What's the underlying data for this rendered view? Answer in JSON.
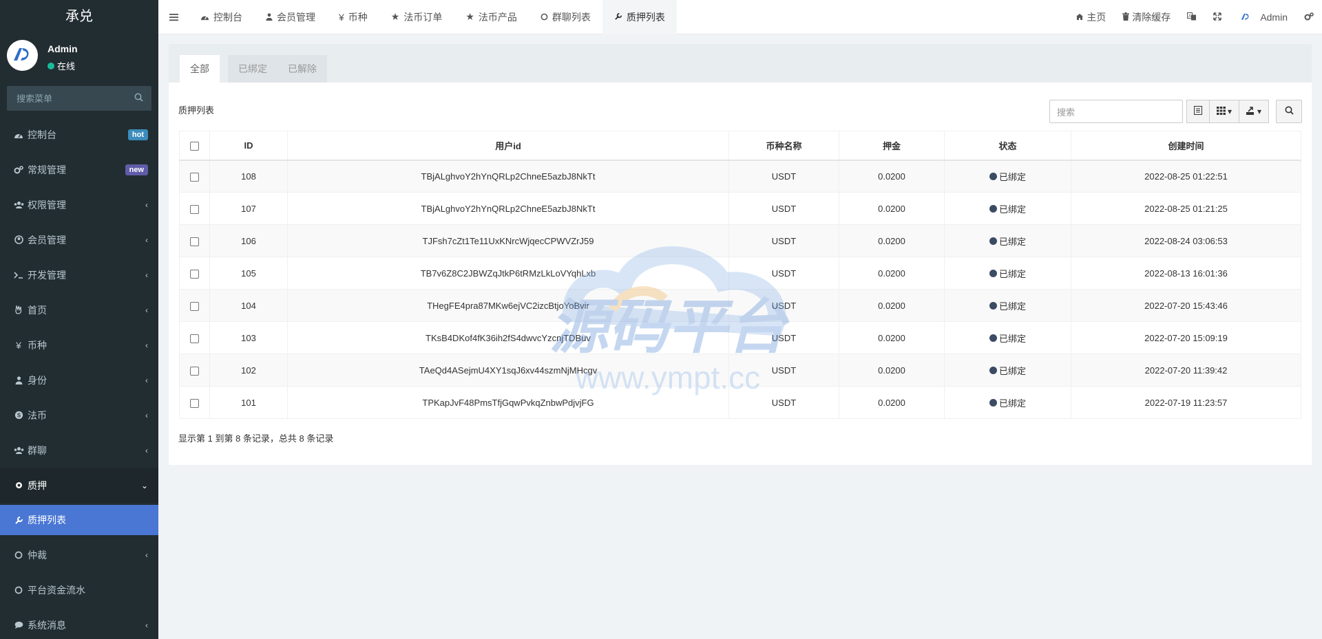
{
  "app": {
    "brand": "承兑"
  },
  "user": {
    "name": "Admin",
    "status": "在线"
  },
  "sidebar": {
    "search_placeholder": "搜索菜单",
    "items": [
      {
        "label": "控制台",
        "icon": "dashboard-icon",
        "badge": "hot"
      },
      {
        "label": "常规管理",
        "icon": "cogs-icon",
        "badge": "new"
      },
      {
        "label": "权限管理",
        "icon": "group-icon"
      },
      {
        "label": "会员管理",
        "icon": "user-circle-icon"
      },
      {
        "label": "开发管理",
        "icon": "terminal-icon"
      },
      {
        "label": "首页",
        "icon": "hand-icon"
      },
      {
        "label": "币种",
        "icon": "yen-icon"
      },
      {
        "label": "身份",
        "icon": "user-icon"
      },
      {
        "label": "法币",
        "icon": "skype-icon"
      },
      {
        "label": "群聊",
        "icon": "users-icon"
      },
      {
        "label": "质押",
        "icon": "gear-icon"
      },
      {
        "label": "质押列表",
        "icon": "wrench-icon"
      },
      {
        "label": "仲裁",
        "icon": "circle-icon"
      },
      {
        "label": "平台资金流水",
        "icon": "circle-icon"
      },
      {
        "label": "系统消息",
        "icon": "comment-icon"
      }
    ]
  },
  "topnav": {
    "tabs": [
      {
        "label": "控制台",
        "icon": "dashboard-icon"
      },
      {
        "label": "会员管理",
        "icon": "user-icon"
      },
      {
        "label": "币种",
        "icon": "yen-icon"
      },
      {
        "label": "法币订单",
        "icon": "star-icon"
      },
      {
        "label": "法币产品",
        "icon": "star-icon"
      },
      {
        "label": "群聊列表",
        "icon": "circle-icon"
      },
      {
        "label": "质押列表",
        "icon": "wrench-icon"
      }
    ],
    "right": {
      "home": "主页",
      "clear_cache": "清除缓存",
      "admin": "Admin"
    }
  },
  "panel": {
    "tabs": [
      "全部",
      "已绑定",
      "已解除"
    ],
    "title": "质押列表",
    "search_placeholder": "搜索",
    "columns": [
      "ID",
      "用户id",
      "币种名称",
      "押金",
      "状态",
      "创建时间"
    ],
    "rows": [
      {
        "id": "108",
        "uid": "TBjALghvoY2hYnQRLp2ChneE5azbJ8NkTt",
        "coin": "USDT",
        "deposit": "0.0200",
        "status": "已绑定",
        "time": "2022-08-25 01:22:51"
      },
      {
        "id": "107",
        "uid": "TBjALghvoY2hYnQRLp2ChneE5azbJ8NkTt",
        "coin": "USDT",
        "deposit": "0.0200",
        "status": "已绑定",
        "time": "2022-08-25 01:21:25"
      },
      {
        "id": "106",
        "uid": "TJFsh7cZt1Te11UxKNrcWjqecCPWVZrJ59",
        "coin": "USDT",
        "deposit": "0.0200",
        "status": "已绑定",
        "time": "2022-08-24 03:06:53"
      },
      {
        "id": "105",
        "uid": "TB7v6Z8C2JBWZqJtkP6tRMzLkLoVYqhLxb",
        "coin": "USDT",
        "deposit": "0.0200",
        "status": "已绑定",
        "time": "2022-08-13 16:01:36"
      },
      {
        "id": "104",
        "uid": "THegFE4pra87MKw6ejVC2izcBtjoYoBvir",
        "coin": "USDT",
        "deposit": "0.0200",
        "status": "已绑定",
        "time": "2022-07-20 15:43:46"
      },
      {
        "id": "103",
        "uid": "TKsB4DKof4fK36ih2fS4dwvcYzcnjTDBuv",
        "coin": "USDT",
        "deposit": "0.0200",
        "status": "已绑定",
        "time": "2022-07-20 15:09:19"
      },
      {
        "id": "102",
        "uid": "TAeQd4ASejmU4XY1sqJ6xv44szmNjMHcgv",
        "coin": "USDT",
        "deposit": "0.0200",
        "status": "已绑定",
        "time": "2022-07-20 11:39:42"
      },
      {
        "id": "101",
        "uid": "TPKapJvF48PmsTfjGqwPvkqZnbwPdjvjFG",
        "coin": "USDT",
        "deposit": "0.0200",
        "status": "已绑定",
        "time": "2022-07-19 11:23:57"
      }
    ],
    "pager": "显示第 1 到第 8 条记录，总共 8 条记录"
  },
  "watermark": {
    "text": "源码平台",
    "url": "www.ympt.cc"
  },
  "colors": {
    "sidebar_bg": "#222d32",
    "active_menu": "#4a77d4",
    "status_dot": "#3c4b64"
  }
}
